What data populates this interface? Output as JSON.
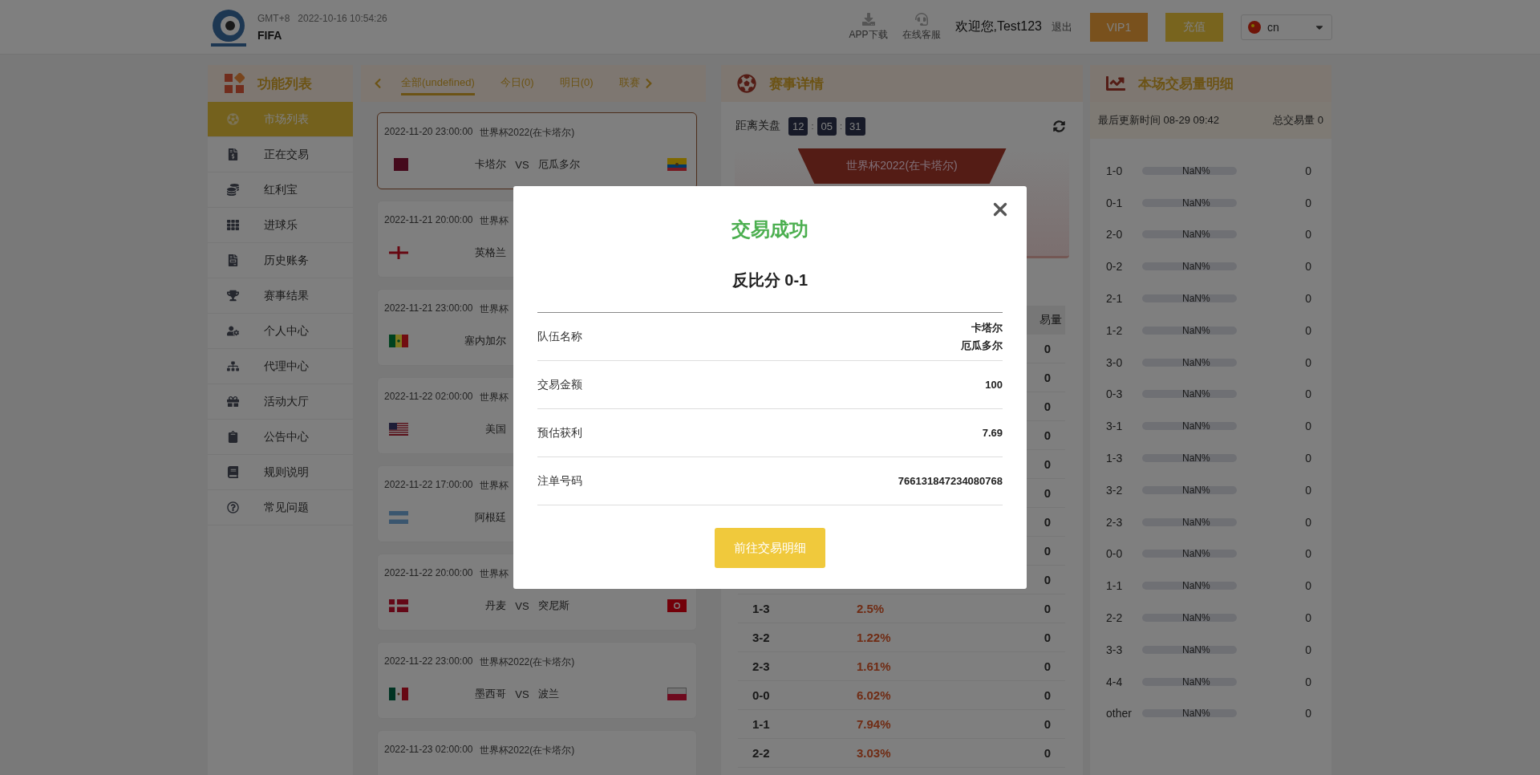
{
  "header": {
    "timezone": "GMT+8",
    "datetime": "2022-10-16 10:54:26",
    "brand": "FIFA",
    "links": [
      {
        "label": "APP下载"
      },
      {
        "label": "在线客服"
      }
    ],
    "welcome": "欢迎您,Test123",
    "logout": "退出",
    "vip_button": "VIP1",
    "recharge_button": "充值",
    "language": "cn"
  },
  "sidebar": {
    "title": "功能列表",
    "items": [
      {
        "label": "市场列表",
        "selected": true
      },
      {
        "label": "正在交易",
        "selected": false
      },
      {
        "label": "红利宝",
        "selected": false
      },
      {
        "label": "进球乐",
        "selected": false
      },
      {
        "label": "历史账务",
        "selected": false
      },
      {
        "label": "赛事结果",
        "selected": false
      },
      {
        "label": "个人中心",
        "selected": false
      },
      {
        "label": "代理中心",
        "selected": false
      },
      {
        "label": "活动大厅",
        "selected": false
      },
      {
        "label": "公告中心",
        "selected": false
      },
      {
        "label": "规则说明",
        "selected": false
      },
      {
        "label": "常见问题",
        "selected": false
      }
    ]
  },
  "matches": {
    "tabs": [
      {
        "label": "全部(undefined)",
        "selected": true
      },
      {
        "label": "今日(0)",
        "selected": false
      },
      {
        "label": "明日(0)",
        "selected": false
      },
      {
        "label": "联赛",
        "selected": false
      }
    ],
    "cards": [
      {
        "time": "2022-11-20 23:00:00",
        "league": "世界杯2022(在卡塔尔)",
        "home": "卡塔尔",
        "vs": "VS",
        "away": "厄瓜多尔",
        "selected": true
      },
      {
        "time": "2022-11-21 20:00:00",
        "league": "世界杯",
        "home": "英格兰",
        "selected": false
      },
      {
        "time": "2022-11-21 23:00:00",
        "league": "世界杯",
        "home": "塞内加尔",
        "selected": false
      },
      {
        "time": "2022-11-22 02:00:00",
        "league": "世界杯",
        "home": "美国",
        "selected": false
      },
      {
        "time": "2022-11-22 17:00:00",
        "league": "世界杯",
        "home": "阿根廷",
        "selected": false
      },
      {
        "time": "2022-11-22 20:00:00",
        "league": "世界杯",
        "home": "丹麦",
        "vs": "VS",
        "away": "突尼斯",
        "selected": false
      },
      {
        "time": "2022-11-22 23:00:00",
        "league": "世界杯2022(在卡塔尔)",
        "home": "墨西哥",
        "vs": "VS",
        "away": "波兰",
        "selected": false
      },
      {
        "time": "2022-11-23 02:00:00",
        "league": "世界杯2022(在卡塔尔)",
        "selected": false
      }
    ]
  },
  "detail": {
    "title": "赛事详情",
    "countdown": {
      "label": "距离关盘",
      "parts": [
        "12",
        "05",
        "31"
      ],
      "separator": ":"
    },
    "banner": "世界杯2022(在卡塔尔)",
    "volume_header": "易量",
    "rows": [
      {
        "volume": "0"
      },
      {
        "volume": "0"
      },
      {
        "volume": "0"
      },
      {
        "volume": "0"
      },
      {
        "volume": "0"
      },
      {
        "volume": "0"
      },
      {
        "volume": "0"
      },
      {
        "volume": "0"
      },
      {
        "volume": "0"
      },
      {
        "score": "1-3",
        "percent": "2.5%",
        "volume": "0"
      },
      {
        "score": "3-2",
        "percent": "1.22%",
        "volume": "0"
      },
      {
        "score": "2-3",
        "percent": "1.61%",
        "volume": "0"
      },
      {
        "score": "0-0",
        "percent": "6.02%",
        "volume": "0"
      },
      {
        "score": "1-1",
        "percent": "7.94%",
        "volume": "0"
      },
      {
        "score": "2-2",
        "percent": "3.03%",
        "volume": "0"
      }
    ]
  },
  "volume_panel": {
    "title": "本场交易量明细",
    "updated": "最后更新时间 08-29 09:42",
    "total": "总交易量 0",
    "rows": [
      {
        "score": "1-0",
        "percent": "NaN%",
        "volume": "0"
      },
      {
        "score": "0-1",
        "percent": "NaN%",
        "volume": "0"
      },
      {
        "score": "2-0",
        "percent": "NaN%",
        "volume": "0"
      },
      {
        "score": "0-2",
        "percent": "NaN%",
        "volume": "0"
      },
      {
        "score": "2-1",
        "percent": "NaN%",
        "volume": "0"
      },
      {
        "score": "1-2",
        "percent": "NaN%",
        "volume": "0"
      },
      {
        "score": "3-0",
        "percent": "NaN%",
        "volume": "0"
      },
      {
        "score": "0-3",
        "percent": "NaN%",
        "volume": "0"
      },
      {
        "score": "3-1",
        "percent": "NaN%",
        "volume": "0"
      },
      {
        "score": "1-3",
        "percent": "NaN%",
        "volume": "0"
      },
      {
        "score": "3-2",
        "percent": "NaN%",
        "volume": "0"
      },
      {
        "score": "2-3",
        "percent": "NaN%",
        "volume": "0"
      },
      {
        "score": "0-0",
        "percent": "NaN%",
        "volume": "0"
      },
      {
        "score": "1-1",
        "percent": "NaN%",
        "volume": "0"
      },
      {
        "score": "2-2",
        "percent": "NaN%",
        "volume": "0"
      },
      {
        "score": "3-3",
        "percent": "NaN%",
        "volume": "0"
      },
      {
        "score": "4-4",
        "percent": "NaN%",
        "volume": "0"
      },
      {
        "score": "other",
        "percent": "NaN%",
        "volume": "0"
      }
    ]
  },
  "modal": {
    "title": "交易成功",
    "subtitle": "反比分 0-1",
    "rows": [
      {
        "label": "队伍名称",
        "values": [
          "卡塔尔",
          "厄瓜多尔"
        ]
      },
      {
        "label": "交易金额",
        "values": [
          "100"
        ]
      },
      {
        "label": "预估获利",
        "values": [
          "7.69"
        ]
      },
      {
        "label": "注单号码",
        "values": [
          "766131847234080768"
        ]
      }
    ],
    "button": "前往交易明细"
  }
}
